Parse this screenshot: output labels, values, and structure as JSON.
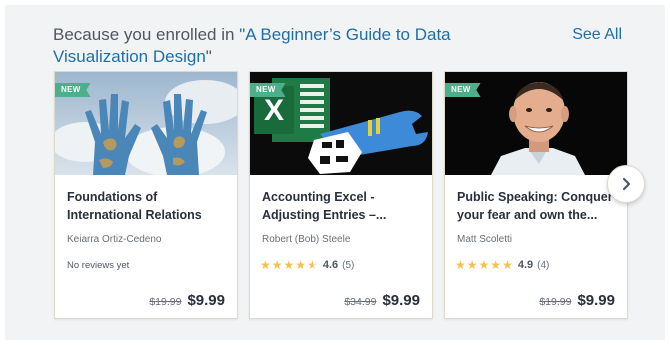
{
  "section": {
    "heading_prefix": "Because you enrolled in ",
    "heading_quote_open": "\"",
    "course_name": "A Beginner’s Guide to Data Visualization Design",
    "heading_quote_close": "\"",
    "see_all_label": "See All"
  },
  "cards": [
    {
      "badge": "NEW",
      "thumbnail_icon": "painted-globe-hands-image",
      "title": "Foundations of\nInternational Relations",
      "author": "Keiarra Ortiz-Cedeno",
      "reviews_text": "No reviews yet",
      "old_price": "$19.99",
      "price": "$9.99"
    },
    {
      "badge": "NEW",
      "thumbnail_icon": "excel-wrench-image",
      "title": "Accounting Excel -\nAdjusting Entries –...",
      "author": "Robert (Bob) Steele",
      "rating": "4.6",
      "rating_count": "(5)",
      "rating_fraction": 0.92,
      "old_price": "$34.99",
      "price": "$9.99"
    },
    {
      "badge": "NEW",
      "thumbnail_icon": "smiling-man-portrait-image",
      "title": "Public Speaking: Conquer\nyour fear and own the...",
      "author": "Matt Scoletti",
      "rating": "4.9",
      "rating_count": "(4)",
      "rating_fraction": 0.98,
      "old_price": "$19.99",
      "price": "$9.99"
    }
  ],
  "colors": {
    "accent": "#1e6fa8",
    "badge": "#4cae8a",
    "star": "#f4c150"
  },
  "next_button_icon": "chevron-right-icon"
}
